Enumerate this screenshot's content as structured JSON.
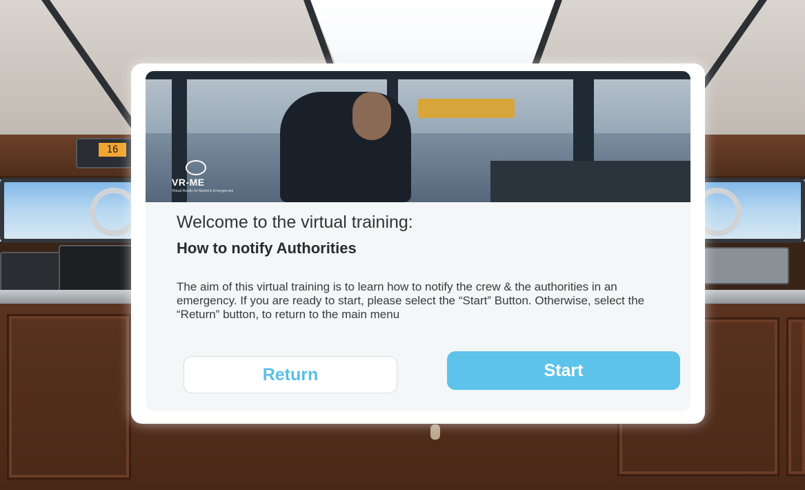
{
  "background": {
    "radio_channel": "16"
  },
  "dialog": {
    "logo": {
      "name": "VR-ME",
      "tagline": "Virtual Reality for Maritime Emergencies"
    },
    "welcome": "Welcome to the virtual training:",
    "title": "How to notify Authorities",
    "description": "The aim of this virtual training is to learn how to notify the crew & the authorities in an emergency. If you are ready to start, please select the “Start” Button. Otherwise, select the “Return” button, to return to the main menu",
    "buttons": {
      "return_label": "Return",
      "start_label": "Start"
    }
  },
  "colors": {
    "accent": "#5ec3ea",
    "return_text": "#5bbfe4",
    "panel": "#f4f7f7"
  }
}
